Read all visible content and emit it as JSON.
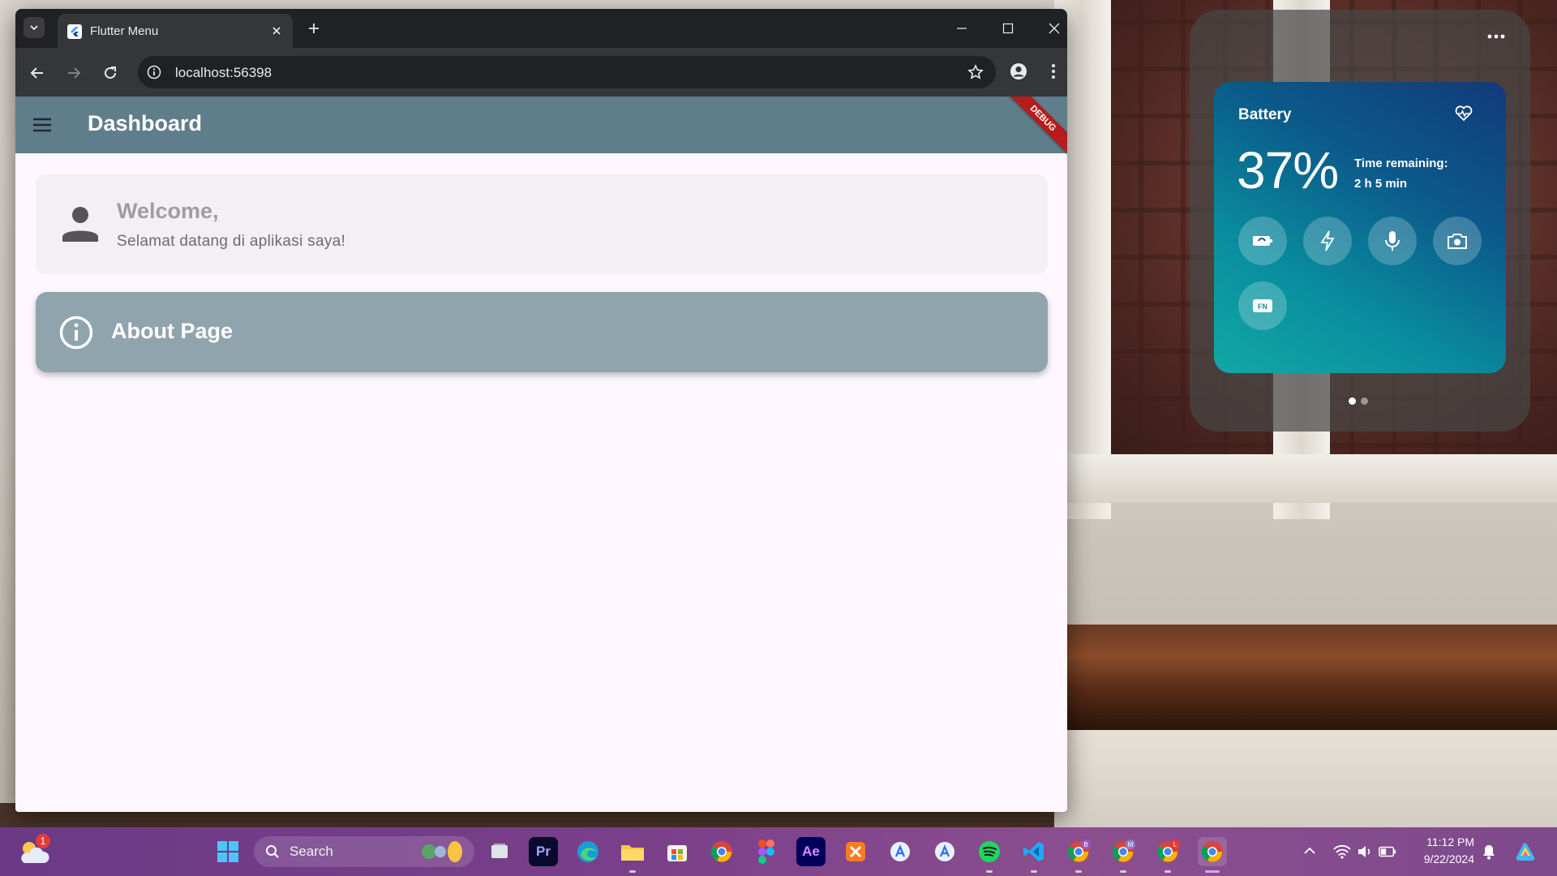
{
  "browser": {
    "tab_title": "Flutter Menu",
    "url": "localhost:56398"
  },
  "app": {
    "appbar_title": "Dashboard",
    "debug_banner": "DEBUG",
    "welcome_title": "Welcome,",
    "welcome_subtitle": "Selamat datang di aplikasi saya!",
    "about_label": "About Page",
    "colors": {
      "appbar": "#607d8b",
      "about_card": "#90a4ae",
      "page_bg": "#fef7ff"
    }
  },
  "widget": {
    "title": "Battery",
    "percent": "37%",
    "time_remaining_label": "Time remaining:",
    "time_remaining_value": "2 h 5 min",
    "fn_label": "FN",
    "quick_buttons": [
      "battery-saver-icon",
      "lightning-icon",
      "microphone-icon",
      "camera-icon",
      "fn-key-icon"
    ],
    "pages": 2,
    "active_page": 1
  },
  "taskbar": {
    "search_label": "Search",
    "weather_badge": "1",
    "clock_time": "11:12 PM",
    "clock_date": "9/22/2024",
    "apps": [
      "file-explorer-icon",
      "premiere-pro-icon",
      "edge-icon",
      "folder-icon",
      "microsoft-store-icon",
      "chrome-icon",
      "figma-icon",
      "after-effects-icon",
      "xampp-icon",
      "app-store-icon",
      "app-store-icon",
      "spotify-icon",
      "vscode-icon",
      "chrome-profile-b-icon",
      "chrome-profile-m-icon",
      "chrome-profile-l-icon",
      "chrome-active-icon"
    ],
    "app_labels": {
      "premiere": "Pr",
      "after_effects": "Ae",
      "profile_b": "B",
      "profile_m": "M",
      "profile_l": "L"
    }
  }
}
